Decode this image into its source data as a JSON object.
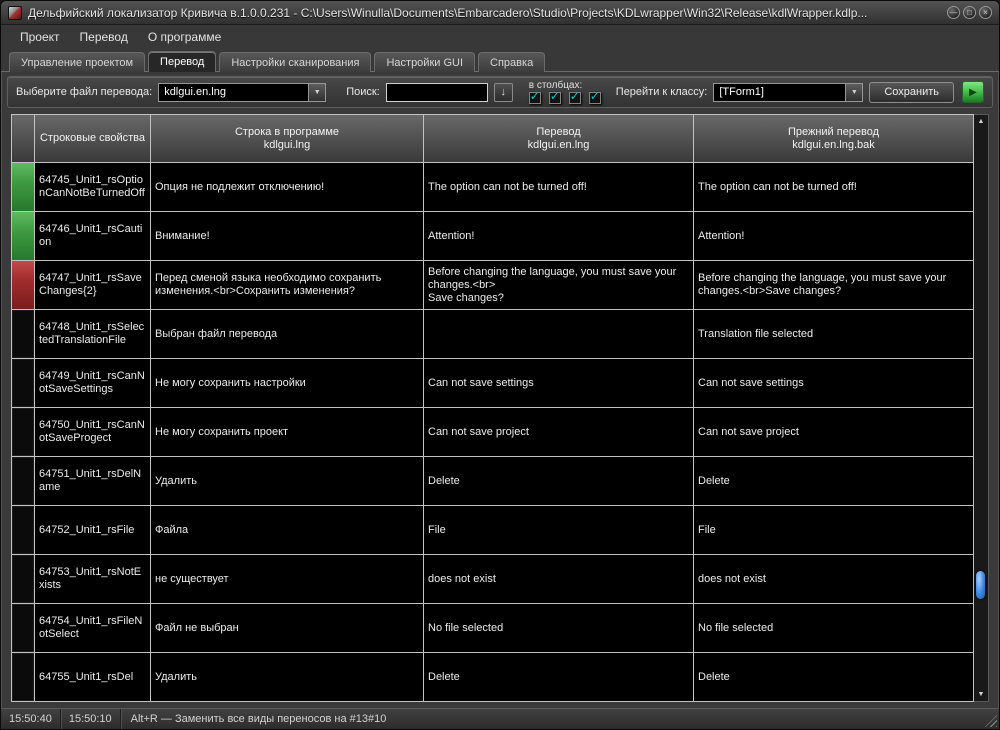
{
  "window": {
    "title": "Дельфийский локализатор Кривича в.1.0.0.231 - C:\\Users\\Winulla\\Documents\\Embarcadero\\Studio\\Projects\\KDLwrapper\\Win32\\Release\\kdlWrapper.kdlp..."
  },
  "icons": {
    "check": "✓",
    "dropdown_arrow": "▼",
    "search_down": "↓",
    "scroll_up": "▲",
    "scroll_down": "▼",
    "run_play": "▶",
    "minimize": "—",
    "maximize": "□",
    "close": "×"
  },
  "colors": {
    "status_green": "#3f9a42",
    "status_red": "#a02c2c",
    "check_teal": "#00c6c6",
    "scroll_thumb": "#3b86e0",
    "run_button_green": "#49c24f"
  },
  "menubar": {
    "items": [
      {
        "label": "Проект"
      },
      {
        "label": "Перевод"
      },
      {
        "label": "О программе"
      }
    ]
  },
  "tabs": [
    {
      "label": "Управление проектом",
      "active": false
    },
    {
      "label": "Перевод",
      "active": true
    },
    {
      "label": "Настройки сканирования",
      "active": false
    },
    {
      "label": "Настройки GUI",
      "active": false
    },
    {
      "label": "Справка",
      "active": false
    }
  ],
  "toolbar": {
    "file_select_label": "Выберите файл перевода:",
    "file_select_value": "kdlgui.en.lng",
    "search_label": "Поиск:",
    "search_value": "",
    "columns_label": "в столбцах:",
    "goto_class_label": "Перейти к классу:",
    "goto_class_value": "[TForm1]",
    "save_button_label": "Сохранить"
  },
  "table": {
    "headers": [
      {
        "label": "Строковые свойства"
      },
      {
        "label": "Строка в программе\nkdlgui.lng"
      },
      {
        "label": "Перевод\nkdlgui.en.lng"
      },
      {
        "label": "Прежний перевод\nkdlgui.en.lng.bak"
      }
    ],
    "rows": [
      {
        "status": "green",
        "id": "64745_Unit1_rsOptionCanNotBeTurnedOff",
        "source": "Опция не подлежит отключению!",
        "translation": "The option can not be turned off!",
        "old": "The option can not be turned off!"
      },
      {
        "status": "green",
        "id": "64746_Unit1_rsCaution",
        "source": "Внимание!",
        "translation": "Attention!",
        "old": "Attention!"
      },
      {
        "status": "red",
        "id": "64747_Unit1_rsSaveChanges{2}",
        "source": "Перед сменой языка необходимо сохранить изменения.<br>Сохранить изменения?",
        "translation": "Before changing the language, you must save your changes.<br>\nSave changes?",
        "old": "Before changing the language, you must save your changes.<br>Save changes?"
      },
      {
        "status": "none",
        "id": "64748_Unit1_rsSelectedTranslationFile",
        "source": "Выбран файл перевода",
        "translation": "",
        "old": "Translation file selected"
      },
      {
        "status": "none",
        "id": "64749_Unit1_rsCanNotSaveSettings",
        "source": "Не могу сохранить настройки",
        "translation": "Can not save settings",
        "old": "Can not save settings"
      },
      {
        "status": "none",
        "id": "64750_Unit1_rsCanNotSaveProgect",
        "source": "Не могу сохранить проект",
        "translation": "Can not save project",
        "old": "Can not save project"
      },
      {
        "status": "none",
        "id": "64751_Unit1_rsDelName",
        "source": "Удалить",
        "translation": "Delete",
        "old": "Delete"
      },
      {
        "status": "none",
        "id": "64752_Unit1_rsFile",
        "source": "Файла",
        "translation": "File",
        "old": "File"
      },
      {
        "status": "none",
        "id": "64753_Unit1_rsNotExists",
        "source": "не существует",
        "translation": "does not exist",
        "old": "does not exist"
      },
      {
        "status": "none",
        "id": "64754_Unit1_rsFileNotSelect",
        "source": "Файл не выбран",
        "translation": "No file selected",
        "old": "No file selected"
      },
      {
        "status": "none",
        "id": "64755_Unit1_rsDel",
        "source": "Удалить",
        "translation": "Delete",
        "old": "Delete"
      }
    ]
  },
  "statusbar": {
    "clock": "15:50:40",
    "session_time": "15:50:10",
    "hint": "Alt+R — Заменить все виды переносов на #13#10"
  }
}
